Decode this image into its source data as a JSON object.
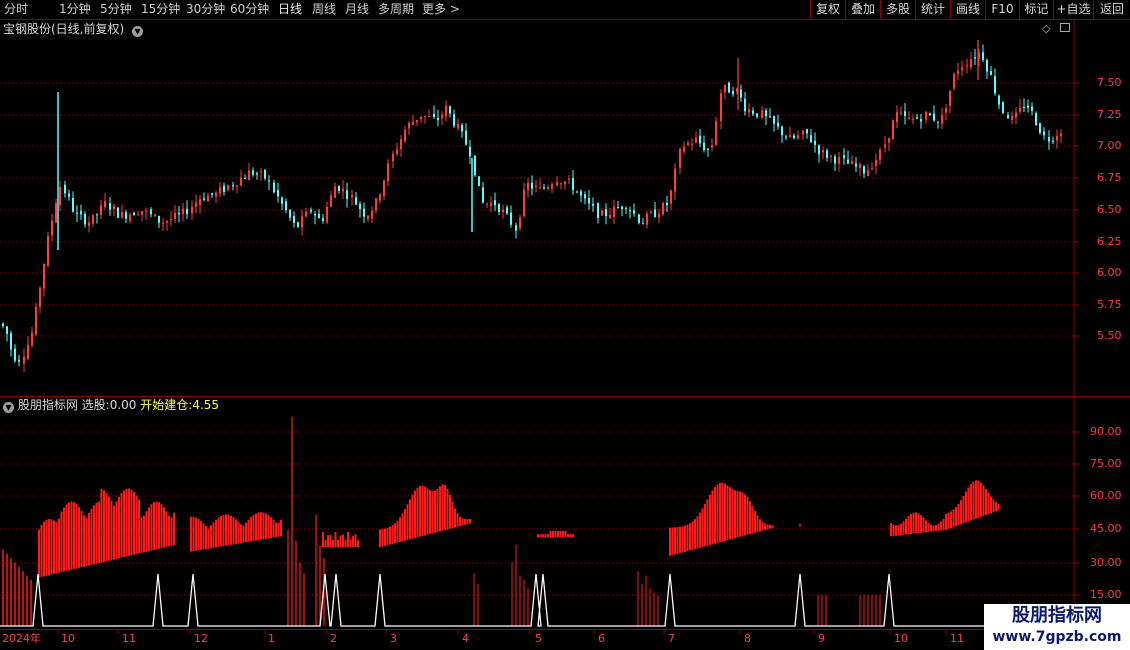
{
  "toolbar": {
    "timeframes": [
      "分时",
      "1分钟",
      "5分钟",
      "15分钟",
      "30分钟",
      "60分钟",
      "日线",
      "周线",
      "月线",
      "多周期",
      "更多 >"
    ],
    "active_timeframe": "日线",
    "right_buttons": [
      "复权",
      "叠加",
      "多股",
      "统计",
      "画线",
      "F10",
      "+自选",
      "返回"
    ],
    "right_mark": "标记"
  },
  "main_chart": {
    "title": "宝钢股份(日线,前复权)",
    "y_ticks": [
      "7.50",
      "7.25",
      "7.00",
      "6.75",
      "6.50",
      "6.25",
      "6.00",
      "5.75",
      "5.50"
    ],
    "colors": {
      "up": "#ff3c3c",
      "down": "#54ffff",
      "grid": "#8b0000",
      "axis": "#8b0000"
    }
  },
  "indicator": {
    "name": "股朋指标网",
    "label1": "选股:",
    "value1": "0.00",
    "label2": "开始建仓:",
    "value2": "4.55",
    "y_ticks": [
      "90.00",
      "75.00",
      "60.00",
      "45.00",
      "30.00",
      "15.00"
    ],
    "colors": {
      "bar": "#ff1a1a",
      "line": "#ffffff",
      "label2": "#ffff40"
    }
  },
  "x_axis": {
    "labels": [
      "2024年",
      "10",
      "11",
      "12",
      "1",
      "2",
      "3",
      "4",
      "5",
      "6",
      "7",
      "8",
      "9",
      "10",
      "11"
    ]
  },
  "watermark": {
    "line1": "股朋指标网",
    "line2": "www.7gpzb.com"
  },
  "icons": [
    "chevron-down-icon",
    "diamond-icon",
    "panel-icon"
  ]
}
